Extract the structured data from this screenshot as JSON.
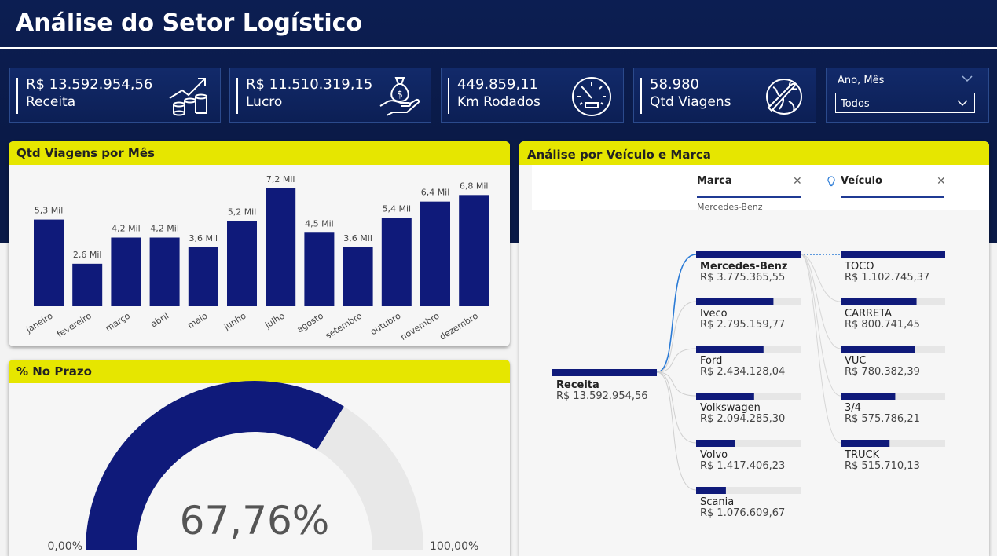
{
  "header": {
    "title": "Análise do Setor Logístico"
  },
  "kpis": [
    {
      "value": "R$ 13.592.954,56",
      "label": "Receita",
      "icon": "money-growth-icon"
    },
    {
      "value": "R$ 11.510.319,15",
      "label": "Lucro",
      "icon": "money-bag-hand-icon"
    },
    {
      "value": "449.859,11",
      "label": "Km Rodados",
      "icon": "speedometer-icon"
    },
    {
      "value": "58.980",
      "label": "Qtd Viagens",
      "icon": "globe-plane-icon"
    }
  ],
  "filter": {
    "label": "Ano, Mês",
    "value": "Todos"
  },
  "panels": {
    "bar_title": "Qtd Viagens por Mês",
    "gauge_title": "% No Prazo",
    "tree_title": "Análise por Veículo e Marca"
  },
  "chart_data": [
    {
      "type": "bar",
      "title": "Qtd Viagens por Mês",
      "categories": [
        "janeiro",
        "fevereiro",
        "março",
        "abril",
        "maio",
        "junho",
        "julho",
        "agosto",
        "setembro",
        "outubro",
        "novembro",
        "dezembro"
      ],
      "values": [
        5.3,
        2.6,
        4.2,
        4.2,
        3.6,
        5.2,
        7.2,
        4.5,
        3.6,
        5.4,
        6.4,
        6.8
      ],
      "data_labels": [
        "5,3 Mil",
        "2,6 Mil",
        "4,2 Mil",
        "4,2 Mil",
        "3,6 Mil",
        "5,2 Mil",
        "7,2 Mil",
        "4,5 Mil",
        "3,6 Mil",
        "5,4 Mil",
        "6,4 Mil",
        "6,8 Mil"
      ],
      "ylim": [
        0,
        7.2
      ],
      "color": "#0f1a7a",
      "grid": false
    },
    {
      "type": "gauge",
      "title": "% No Prazo",
      "value": 67.76,
      "value_label": "67,76%",
      "min_label": "0,00%",
      "max_label": "100,00%",
      "range": [
        0,
        100
      ],
      "fill_color": "#0f1a7a",
      "track_color": "#e8e8e8"
    }
  ],
  "tree": {
    "filters": {
      "marca_label": "Marca",
      "marca_value": "Mercedes-Benz",
      "veiculo_label": "Veículo"
    },
    "root": {
      "name": "Receita",
      "value": "R$ 13.592.954,56"
    },
    "brands": [
      {
        "name": "Mercedes-Benz",
        "value": "R$ 3.775.365,55",
        "fraction": 1.0,
        "selected": true
      },
      {
        "name": "Iveco",
        "value": "R$ 2.795.159,77",
        "fraction": 0.74
      },
      {
        "name": "Ford",
        "value": "R$ 2.434.128,04",
        "fraction": 0.645
      },
      {
        "name": "Volkswagen",
        "value": "R$ 2.094.285,30",
        "fraction": 0.555
      },
      {
        "name": "Volvo",
        "value": "R$ 1.417.406,23",
        "fraction": 0.375
      },
      {
        "name": "Scania",
        "value": "R$ 1.076.609,67",
        "fraction": 0.285
      }
    ],
    "vehicles": [
      {
        "name": "TOCO",
        "value": "R$ 1.102.745,37",
        "fraction": 1.0
      },
      {
        "name": "CARRETA",
        "value": "R$ 800.741,45",
        "fraction": 0.726
      },
      {
        "name": "VUC",
        "value": "R$ 780.382,39",
        "fraction": 0.708
      },
      {
        "name": "3/4",
        "value": "R$ 575.786,21",
        "fraction": 0.522
      },
      {
        "name": "TRUCK",
        "value": "R$ 515.710,13",
        "fraction": 0.468
      }
    ],
    "colors": {
      "bar": "#0f1a7a",
      "track": "#e6e6e6",
      "link": "#2b7bd6"
    }
  }
}
